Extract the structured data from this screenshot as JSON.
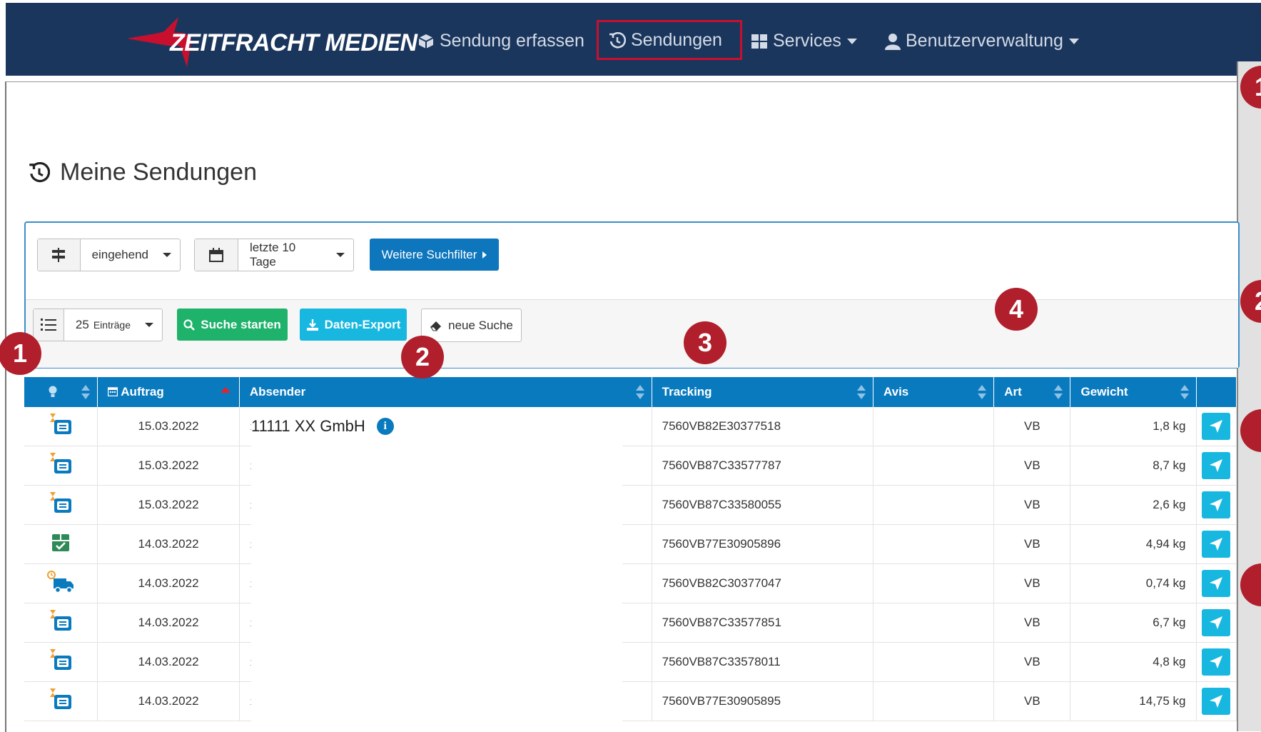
{
  "nav": {
    "brand": "ZEITFRACHT MEDIEN",
    "items": [
      {
        "label": "Sendung erfassen",
        "icon": "box-icon"
      },
      {
        "label": "Sendungen",
        "icon": "history-icon",
        "active": true
      },
      {
        "label": "Services",
        "icon": "grid-icon",
        "dropdown": true
      },
      {
        "label": "Benutzerverwaltung",
        "icon": "user-icon",
        "dropdown": true
      }
    ]
  },
  "page": {
    "title": "Meine Sendungen"
  },
  "filters": {
    "direction": "eingehend",
    "period": "letzte 10 Tage",
    "more_filters": "Weitere Suchfilter",
    "entries_count": "25",
    "entries_unit": "Einträge",
    "search": "Suche starten",
    "export": "Daten-Export",
    "new_search": "neue Suche"
  },
  "table": {
    "columns": [
      "Auftrag",
      "Absender",
      "Tracking",
      "Avis",
      "Art",
      "Gewicht"
    ],
    "first_sender": "11111 XX GmbH",
    "rows": [
      {
        "status": "pending",
        "date": "15.03.2022",
        "tracking": "7560VB82E30377518",
        "avis": "",
        "art": "VB",
        "weight": "1,8 kg"
      },
      {
        "status": "pending",
        "date": "15.03.2022",
        "tracking": "7560VB87C33577787",
        "avis": "",
        "art": "VB",
        "weight": "8,7 kg"
      },
      {
        "status": "pending",
        "date": "15.03.2022",
        "tracking": "7560VB87C33580055",
        "avis": "",
        "art": "VB",
        "weight": "2,6 kg"
      },
      {
        "status": "delivered",
        "date": "14.03.2022",
        "tracking": "7560VB77E30905896",
        "avis": "",
        "art": "VB",
        "weight": "4,94 kg"
      },
      {
        "status": "in-transit",
        "date": "14.03.2022",
        "tracking": "7560VB82C30377047",
        "avis": "",
        "art": "VB",
        "weight": "0,74 kg"
      },
      {
        "status": "pending",
        "date": "14.03.2022",
        "tracking": "7560VB87C33577851",
        "avis": "",
        "art": "VB",
        "weight": "6,7 kg"
      },
      {
        "status": "pending",
        "date": "14.03.2022",
        "tracking": "7560VB87C33578011",
        "avis": "",
        "art": "VB",
        "weight": "4,8 kg"
      },
      {
        "status": "pending",
        "date": "14.03.2022",
        "tracking": "7560VB77E30905895",
        "avis": "",
        "art": "VB",
        "weight": "14,75 kg"
      }
    ]
  },
  "annotations": {
    "m1": "1",
    "m2": "2",
    "m3": "3",
    "m4": "4",
    "side1": "1",
    "side2": "2"
  },
  "colors": {
    "navbar": "#1b365d",
    "accent_red": "#c8102e",
    "table_header": "#0a7abf",
    "marker": "#b01f2b"
  }
}
